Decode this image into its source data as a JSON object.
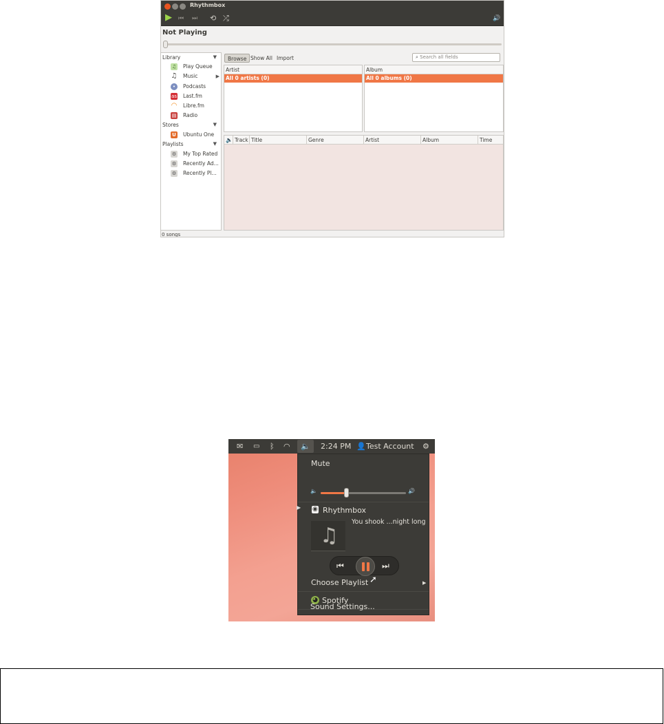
{
  "rhythmbox": {
    "title": "Rhythmbox",
    "now_playing": "Not Playing",
    "sidebar": {
      "library_heading": "Library",
      "library_items": [
        "Play Queue",
        "Music",
        "Podcasts",
        "Last.fm",
        "Libre.fm",
        "Radio"
      ],
      "stores_heading": "Stores",
      "stores_items": [
        "Ubuntu One"
      ],
      "playlists_heading": "Playlists",
      "playlists_items": [
        "My Top Rated",
        "Recently Ad...",
        "Recently Pl..."
      ]
    },
    "browse_bar": {
      "browse_label": "Browse",
      "show_all_label": "Show All",
      "import_label": "Import",
      "search_placeholder": "Search all fields"
    },
    "artist_pane": {
      "header": "Artist",
      "row": "All 0 artists (0)"
    },
    "album_pane": {
      "header": "Album",
      "row": "All 0 albums (0)"
    },
    "song_columns": [
      "Track",
      "Title",
      "Genre",
      "Artist",
      "Album",
      "Time"
    ],
    "status": "0 songs"
  },
  "sound_menu": {
    "panel": {
      "time": "2:24 PM",
      "account": "Test Account"
    },
    "mute_label": "Mute",
    "volume_fraction": 0.3,
    "player_name": "Rhythmbox",
    "track_text": "You shook ...night long",
    "choose_playlist": "Choose Playlist",
    "spotify": "Spotify",
    "sound_settings": "Sound Settings..."
  },
  "colors": {
    "accent": "#f07746",
    "panel": "#3c3b37"
  },
  "icons": [
    "close-icon",
    "minimize-icon",
    "maximize-icon",
    "play-icon",
    "previous-icon",
    "next-icon",
    "repeat-icon",
    "shuffle-icon",
    "volume-icon",
    "mail-icon",
    "battery-icon",
    "bluetooth-icon",
    "wifi-icon",
    "user-icon",
    "gear-icon",
    "music-note-icon",
    "pause-icon"
  ]
}
